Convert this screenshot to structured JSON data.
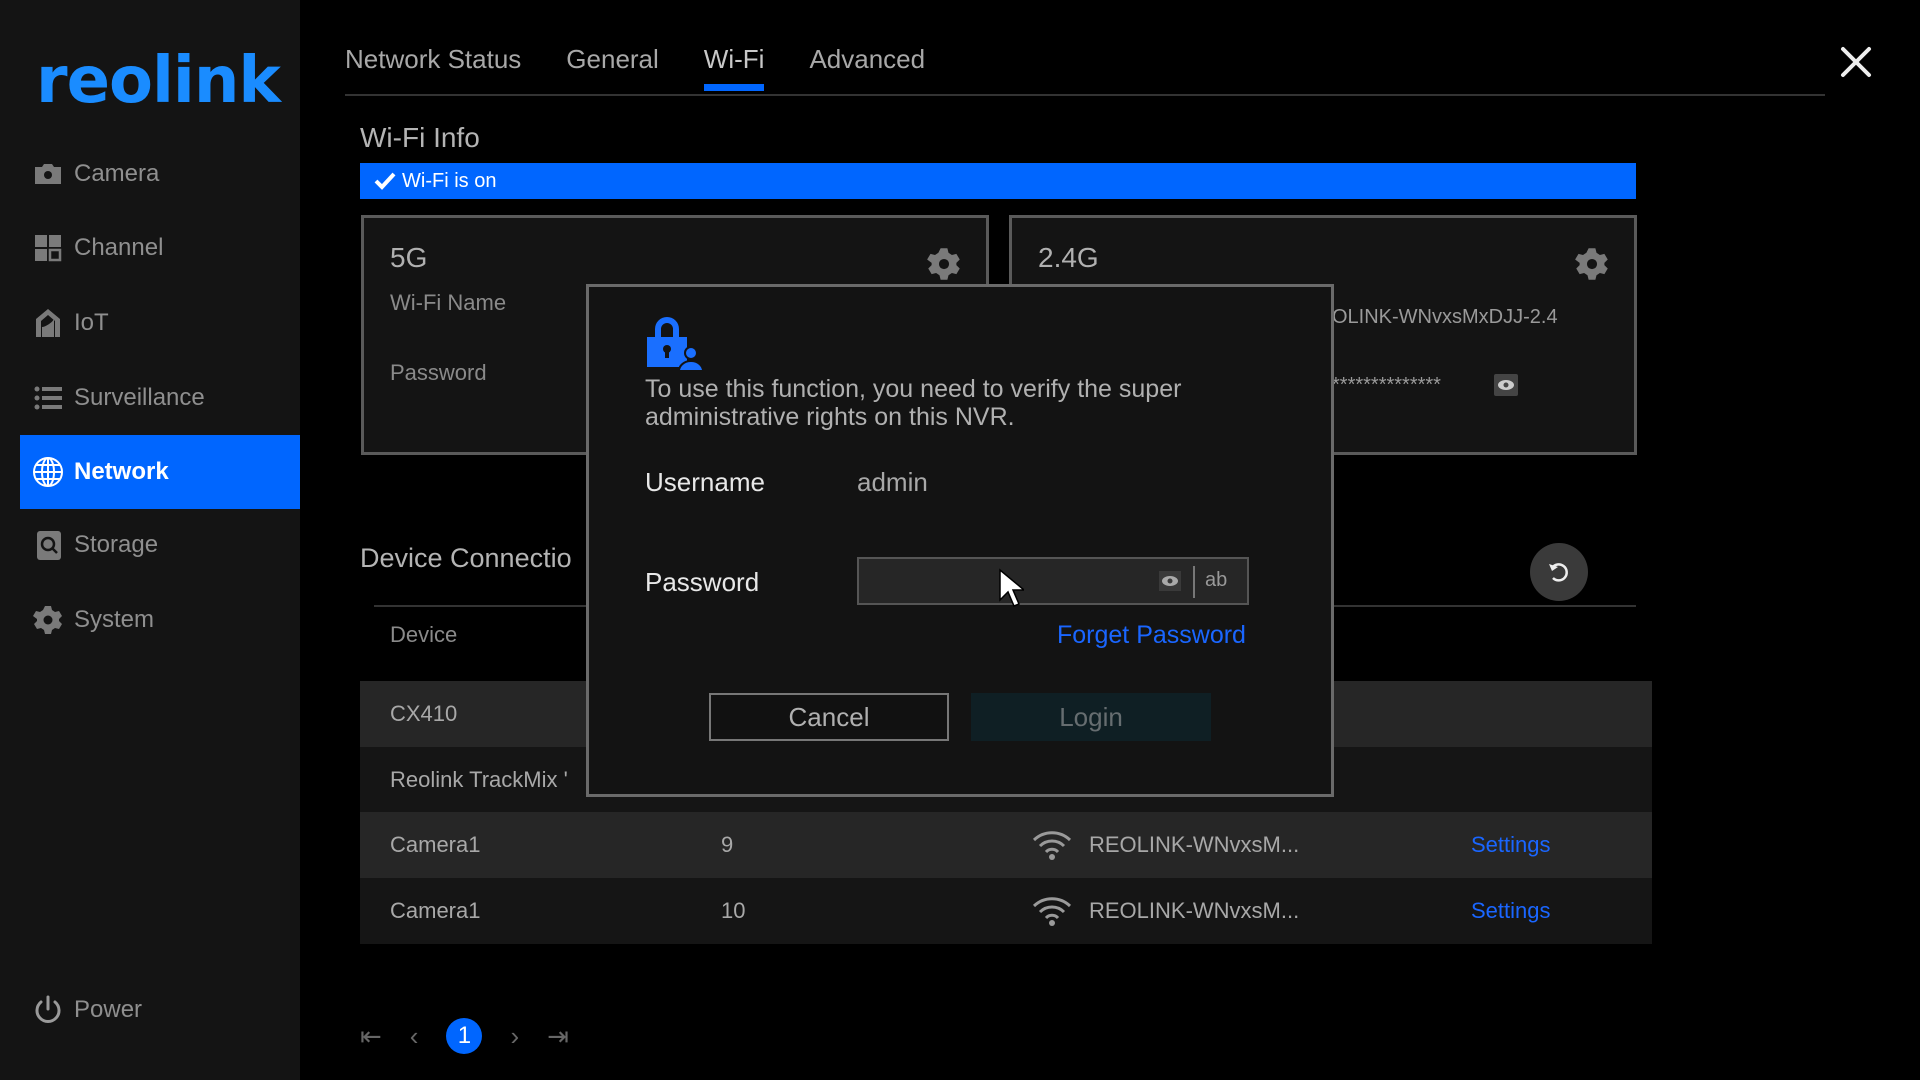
{
  "app": {
    "brand": "reolink",
    "accent_color": "#0066ff"
  },
  "sidebar": {
    "items": [
      {
        "label": "Camera",
        "icon": "camera-icon",
        "active": false
      },
      {
        "label": "Channel",
        "icon": "channel-grid-icon",
        "active": false
      },
      {
        "label": "IoT",
        "icon": "iot-house-icon",
        "active": false
      },
      {
        "label": "Surveillance",
        "icon": "list-icon",
        "active": false
      },
      {
        "label": "Network",
        "icon": "globe-icon",
        "active": true
      },
      {
        "label": "Storage",
        "icon": "storage-icon",
        "active": false
      },
      {
        "label": "System",
        "icon": "gear-icon",
        "active": false
      }
    ],
    "power_label": "Power"
  },
  "tabs": [
    {
      "label": "Network Status",
      "active": false
    },
    {
      "label": "General",
      "active": false
    },
    {
      "label": "Wi-Fi",
      "active": true
    },
    {
      "label": "Advanced",
      "active": false
    }
  ],
  "wifi_info": {
    "title": "Wi-Fi Info",
    "status_text": "Wi-Fi is on",
    "cards": [
      {
        "band": "5G",
        "name_label": "Wi-Fi Name",
        "password_label": "Password"
      },
      {
        "band": "2.4G",
        "name_value": "OLINK-WNvxsMxDJJ-2.4",
        "password_value": "**************"
      }
    ]
  },
  "device_connection": {
    "title": "Device Connectio",
    "columns": [
      "Device"
    ],
    "rows": [
      {
        "device": "CX410",
        "channel": "",
        "network": "",
        "action": ""
      },
      {
        "device": "Reolink TrackMix '",
        "channel": "",
        "network": "",
        "action": ""
      },
      {
        "device": "Camera1",
        "channel": "9",
        "network": "REOLINK-WNvxsM...",
        "action": "Settings"
      },
      {
        "device": "Camera1",
        "channel": "10",
        "network": "REOLINK-WNvxsM...",
        "action": "Settings"
      }
    ]
  },
  "pagination": {
    "current_page": "1"
  },
  "dialog": {
    "message": "To use this function, you need to verify the super administrative rights on this NVR.",
    "username_label": "Username",
    "username_value": "admin",
    "password_label": "Password",
    "password_value": "",
    "password_toggle_label": "ab",
    "forget_password": "Forget Password",
    "cancel_label": "Cancel",
    "login_label": "Login"
  }
}
